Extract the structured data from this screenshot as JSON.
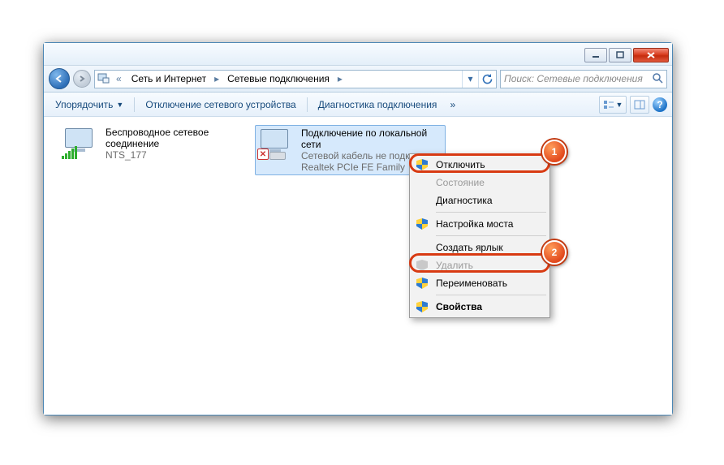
{
  "window": {
    "breadcrumb_root": "Сеть и Интернет",
    "breadcrumb_current": "Сетевые подключения",
    "search_placeholder": "Поиск: Сетевые подключения"
  },
  "toolbar": {
    "organize": "Упорядочить",
    "disable_device": "Отключение сетевого устройства",
    "diagnose": "Диагностика подключения"
  },
  "connections": {
    "wireless": {
      "title": "Беспроводное сетевое соединение",
      "ssid": "NTS_177"
    },
    "lan": {
      "title": "Подключение по локальной сети",
      "status": "Сетевой кабель не подключен",
      "adapter": "Realtek PCIe FE Family"
    }
  },
  "context_menu": {
    "disable": "Отключить",
    "status": "Состояние",
    "diagnose": "Диагностика",
    "bridge": "Настройка моста",
    "shortcut": "Создать ярлык",
    "delete": "Удалить",
    "rename": "Переименовать",
    "properties": "Свойства"
  },
  "callouts": {
    "one": "1",
    "two": "2"
  }
}
